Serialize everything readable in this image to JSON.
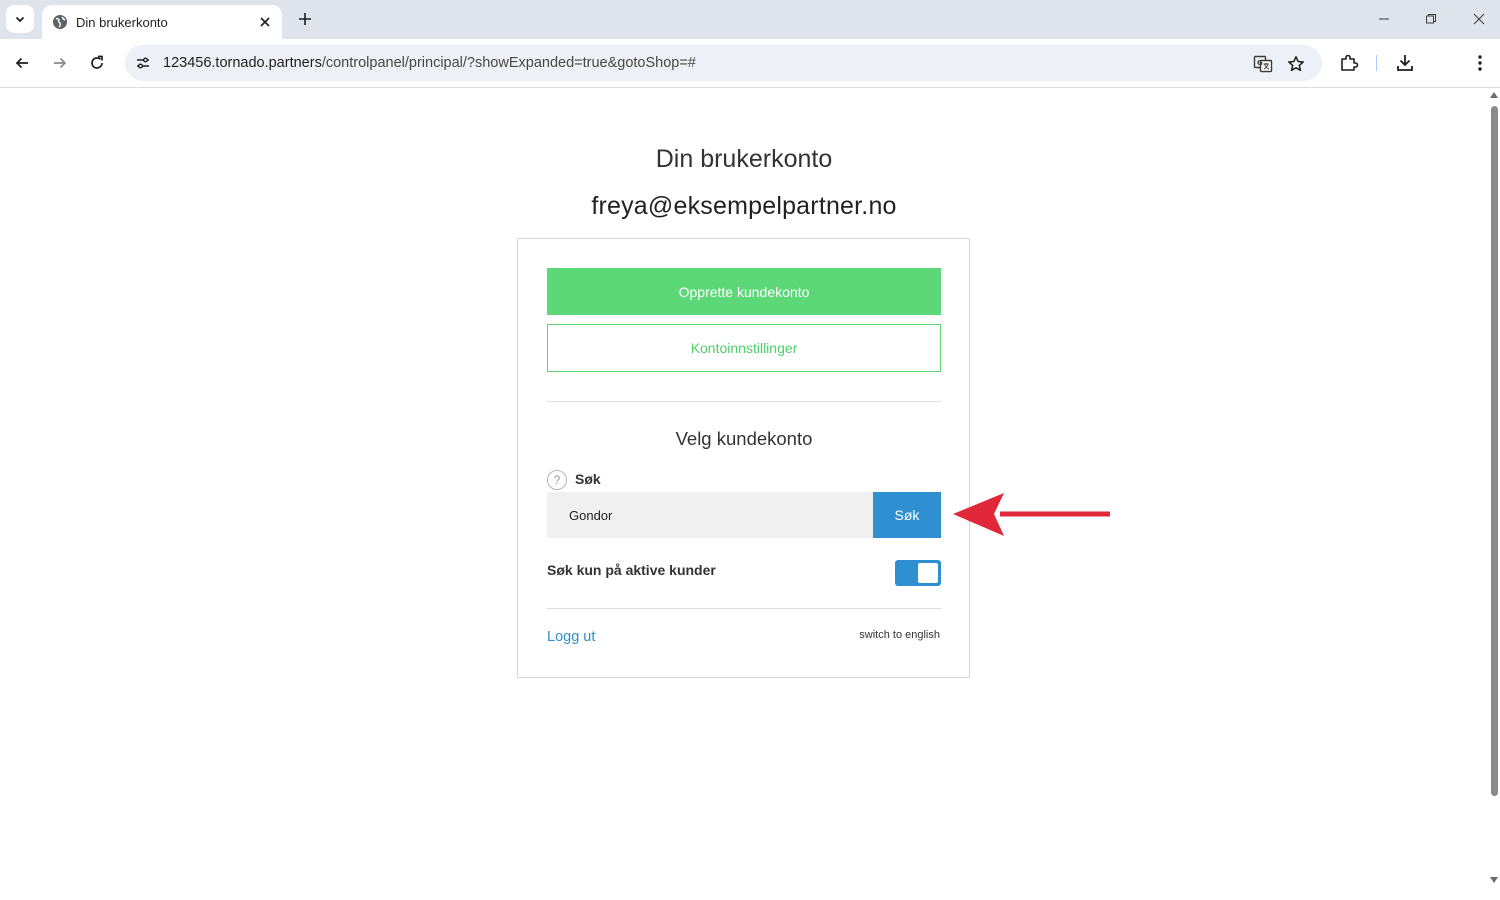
{
  "browser": {
    "tab_title": "Din brukerkonto",
    "url_host": "123456.tornado.partners",
    "url_path": "/controlpanel/principal/?showExpanded=true&gotoShop=#",
    "icons": {
      "tab_search": "chevron-down-icon",
      "favicon": "globe-icon",
      "tab_close": "close-icon",
      "new_tab": "plus-icon",
      "minimize": "minimize-icon",
      "restore": "restore-icon",
      "close_window": "close-icon",
      "back": "arrow-left-icon",
      "forward": "arrow-right-icon",
      "reload": "reload-icon",
      "site_info": "tune-icon",
      "translate": "translate-icon",
      "bookmark": "star-icon",
      "extensions": "puzzle-icon",
      "downloads": "download-icon",
      "menu": "kebab-menu-icon"
    }
  },
  "page": {
    "title": "Din brukerkonto",
    "email": "freya@eksempelpartner.no",
    "create_button": "Opprette kundekonto",
    "settings_button": "Kontoinnstillinger",
    "section_title": "Velg kundekonto",
    "search_label": "Søk",
    "search_value": "Gondor",
    "search_button": "Søk",
    "help_icon": "?",
    "toggle_label": "Søk kun på aktive kunder",
    "toggle_on": true,
    "logout_link": "Logg ut",
    "language_link": "switch to english"
  },
  "colors": {
    "primary_green": "#5dd879",
    "primary_blue": "#2e8fd1",
    "annotation_red": "#e0283a"
  }
}
